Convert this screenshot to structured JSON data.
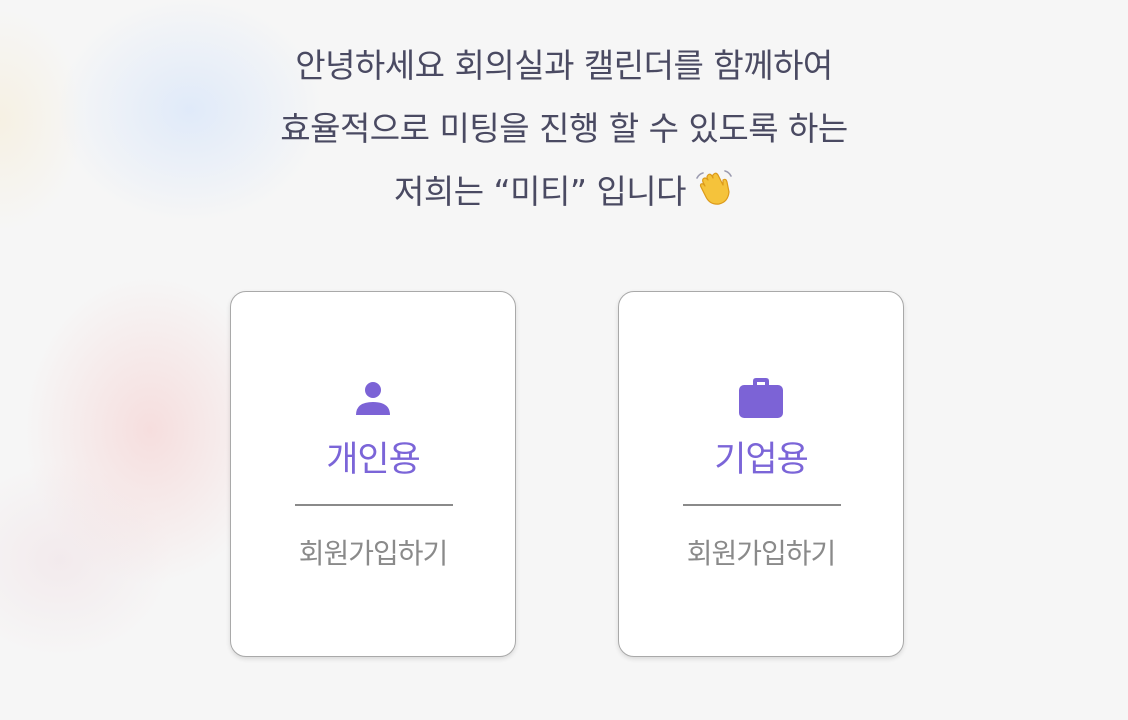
{
  "intro": {
    "line1": "안녕하세요 회의실과 캘린더를 함께하여",
    "line2": "효율적으로 미팅을 진행 할 수 있도록 하는",
    "line3": "저희는 “미티” 입니다",
    "line3_icon": "waving-hand-icon"
  },
  "cards": [
    {
      "icon": "person-icon",
      "title": "개인용",
      "action": "회원가입하기"
    },
    {
      "icon": "briefcase-icon",
      "title": "기업용",
      "action": "회원가입하기"
    }
  ],
  "colors": {
    "accent": "#7b65d8",
    "icon": "#7c63d6",
    "intro_text": "#4a4a62",
    "muted_text": "#8a8a8a",
    "card_border": "#a9a9a9",
    "background": "#f6f6f6"
  }
}
